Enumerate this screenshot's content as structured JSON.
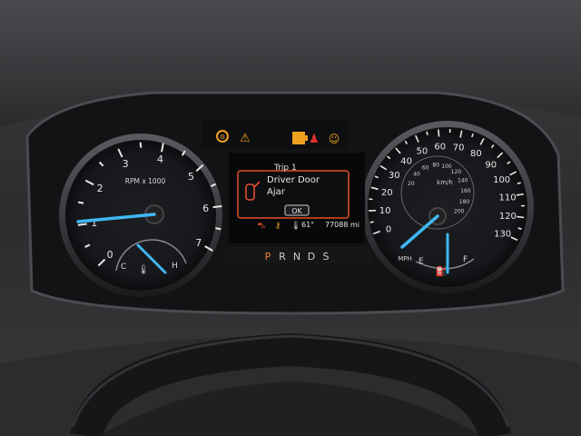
{
  "tachometer": {
    "label": "RPM x 1000",
    "ticks": [
      "0",
      "1",
      "2",
      "3",
      "4",
      "5",
      "6",
      "7"
    ],
    "needle_value": 0,
    "temp_labels": [
      "C",
      "H"
    ]
  },
  "speedometer": {
    "mph_ticks": [
      "0",
      "10",
      "20",
      "30",
      "40",
      "50",
      "60",
      "70",
      "80",
      "90",
      "100",
      "110",
      "120",
      "130"
    ],
    "kmh_ticks": [
      "20",
      "40",
      "60",
      "80",
      "100",
      "120",
      "140",
      "160",
      "180",
      "200"
    ],
    "kmh_label": "km/h",
    "mph_label": "MPH",
    "needle_value": 0,
    "fuel_labels": [
      "E",
      "F"
    ],
    "fuel_level": 0.5
  },
  "display": {
    "title": "Trip 1",
    "message_line1": "Driver Door",
    "message_line2": "Ajar",
    "ok_button": "OK",
    "outside_temp": "61°",
    "odometer": "77088 mi"
  },
  "gear": {
    "options": [
      "P",
      "R",
      "N",
      "D",
      "S"
    ],
    "selected": "P"
  },
  "colors": {
    "needle": "#3fb8f5",
    "amber": "#f0a020",
    "warning_red": "#e03030",
    "selected_gear": "#f08030"
  }
}
